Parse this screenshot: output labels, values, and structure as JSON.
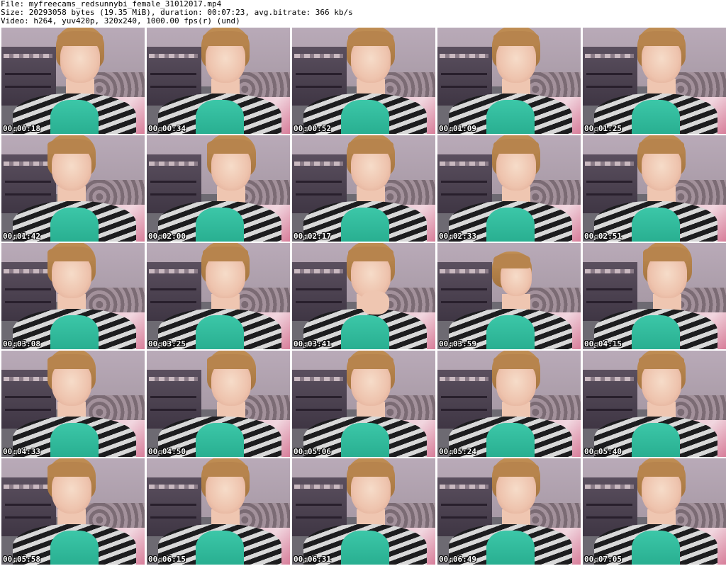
{
  "header": {
    "line1": "File: myfreecams_redsunnybi_female_31012017.mp4",
    "line2": "Size: 20293058 bytes (19.35 MiB), duration: 00:07:23, avg.bitrate: 366 kb/s",
    "line3": "Video: h264, yuv420p, 320x240, 1000.00 fps(r) (und)"
  },
  "thumbnails": [
    {
      "time": "00:00:18",
      "pose": "center"
    },
    {
      "time": "00:00:34",
      "pose": "center"
    },
    {
      "time": "00:00:52",
      "pose": "center"
    },
    {
      "time": "00:01:09",
      "pose": "center"
    },
    {
      "time": "00:01:25",
      "pose": "center"
    },
    {
      "time": "00:01:42",
      "pose": "left"
    },
    {
      "time": "00:02:00",
      "pose": "right"
    },
    {
      "time": "00:02:17",
      "pose": "center"
    },
    {
      "time": "00:02:33",
      "pose": "center"
    },
    {
      "time": "00:02:51",
      "pose": "center"
    },
    {
      "time": "00:03:08",
      "pose": "left"
    },
    {
      "time": "00:03:25",
      "pose": "center"
    },
    {
      "time": "00:03:41",
      "pose": "hand"
    },
    {
      "time": "00:03:59",
      "pose": "small"
    },
    {
      "time": "00:04:15",
      "pose": "right"
    },
    {
      "time": "00:04:33",
      "pose": "left"
    },
    {
      "time": "00:04:50",
      "pose": "right"
    },
    {
      "time": "00:05:06",
      "pose": "center"
    },
    {
      "time": "00:05:24",
      "pose": "center"
    },
    {
      "time": "00:05:40",
      "pose": "center"
    },
    {
      "time": "00:05:58",
      "pose": "left"
    },
    {
      "time": "00:06:15",
      "pose": "center"
    },
    {
      "time": "00:06:31",
      "pose": "center"
    },
    {
      "time": "00:06:49",
      "pose": "center"
    },
    {
      "time": "00:07:05",
      "pose": "center"
    }
  ]
}
